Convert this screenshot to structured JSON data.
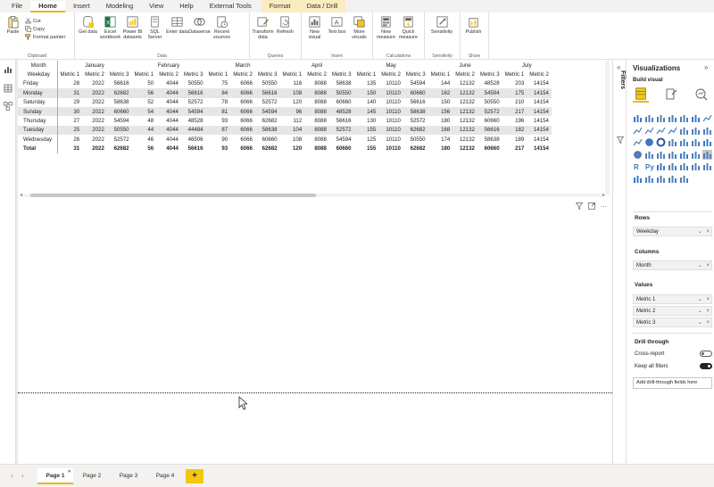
{
  "menu": {
    "tabs": [
      "File",
      "Home",
      "Insert",
      "Modeling",
      "View",
      "Help",
      "External Tools"
    ],
    "active": "Home",
    "context_tabs": [
      "Format",
      "Data / Drill"
    ]
  },
  "ribbon": {
    "clipboard": {
      "paste": "Paste",
      "cut": "Cut",
      "copy": "Copy",
      "format_painter": "Format painter",
      "group": "Clipboard"
    },
    "data": {
      "group": "Data",
      "buttons": [
        "Get data",
        "Excel workbook",
        "Power BI datasets",
        "SQL Server",
        "Enter data",
        "Dataverse",
        "Recent sources"
      ]
    },
    "queries": {
      "group": "Queries",
      "buttons": [
        "Transform data",
        "Refresh"
      ]
    },
    "insert": {
      "group": "Insert",
      "buttons": [
        "New visual",
        "Text box",
        "More visuals"
      ]
    },
    "calculations": {
      "group": "Calculations",
      "buttons": [
        "New measure",
        "Quick measure"
      ]
    },
    "sensitivity": {
      "group": "Sensitivity",
      "buttons": [
        "Sensitivity"
      ]
    },
    "share": {
      "group": "Share",
      "buttons": [
        "Publish"
      ]
    }
  },
  "matrix": {
    "row_header_title": "Month",
    "row_field": "Weekday",
    "months": [
      "January",
      "February",
      "March",
      "April",
      "May",
      "June",
      "July"
    ],
    "metric_headers": [
      "Metric 1",
      "Metric 2",
      "Metric 3"
    ],
    "rows": [
      {
        "label": "Friday",
        "values": [
          "28",
          "2022",
          "56616",
          "50",
          "4044",
          "50550",
          "75",
          "6066",
          "50550",
          "116",
          "8088",
          "58638",
          "135",
          "10110",
          "54594",
          "144",
          "12132",
          "48528",
          "203",
          "14154"
        ]
      },
      {
        "label": "Monday",
        "values": [
          "31",
          "2022",
          "62682",
          "56",
          "4044",
          "56616",
          "84",
          "6066",
          "56616",
          "108",
          "8088",
          "50550",
          "150",
          "10110",
          "60660",
          "162",
          "12132",
          "54594",
          "175",
          "14154"
        ]
      },
      {
        "label": "Saturday",
        "values": [
          "29",
          "2022",
          "58638",
          "52",
          "4044",
          "52572",
          "78",
          "6066",
          "52572",
          "120",
          "8088",
          "60660",
          "140",
          "10110",
          "56616",
          "150",
          "12132",
          "50550",
          "210",
          "14154"
        ]
      },
      {
        "label": "Sunday",
        "values": [
          "30",
          "2022",
          "60660",
          "54",
          "4044",
          "54594",
          "81",
          "6066",
          "54594",
          "96",
          "8088",
          "48528",
          "145",
          "10110",
          "58638",
          "156",
          "12132",
          "52572",
          "217",
          "14154"
        ]
      },
      {
        "label": "Thursday",
        "values": [
          "27",
          "2022",
          "54594",
          "48",
          "4044",
          "48528",
          "93",
          "6066",
          "62682",
          "112",
          "8088",
          "56616",
          "130",
          "10110",
          "52572",
          "180",
          "12132",
          "60660",
          "196",
          "14154"
        ]
      },
      {
        "label": "Tuesday",
        "values": [
          "25",
          "2022",
          "50550",
          "44",
          "4044",
          "44484",
          "87",
          "6066",
          "58638",
          "104",
          "8088",
          "52572",
          "155",
          "10110",
          "62682",
          "168",
          "12132",
          "56616",
          "182",
          "14154"
        ]
      },
      {
        "label": "Wednesday",
        "values": [
          "26",
          "2022",
          "52572",
          "46",
          "4044",
          "46506",
          "90",
          "6066",
          "60660",
          "108",
          "8088",
          "54594",
          "125",
          "10110",
          "50550",
          "174",
          "12132",
          "58638",
          "189",
          "14154"
        ]
      }
    ],
    "total": {
      "label": "Total",
      "values": [
        "31",
        "2022",
        "62682",
        "56",
        "4044",
        "56616",
        "93",
        "6066",
        "62682",
        "120",
        "8088",
        "60660",
        "155",
        "10110",
        "62682",
        "180",
        "12132",
        "60660",
        "217",
        "14154"
      ]
    }
  },
  "pages": {
    "tabs": [
      "Page 1",
      "Page 2",
      "Page 3",
      "Page 4"
    ],
    "active": "Page 1",
    "add": "+"
  },
  "filters": {
    "label": "Filters"
  },
  "viz": {
    "title": "Visualizations",
    "build_visual": "Build visual",
    "rows_label": "Rows",
    "rows_field": "Weekday",
    "columns_label": "Columns",
    "columns_field": "Month",
    "values_label": "Values",
    "values_fields": [
      "Metric 1",
      "Metric 2",
      "Metric 3"
    ],
    "drill_label": "Drill through",
    "cross_report": "Cross-report",
    "keep_filters": "Keep all filters",
    "add_drill": "Add drill-through fields here",
    "r_visual": "R",
    "py_visual": "Py",
    "more": "..."
  },
  "colors": {
    "accent": "#f2c811",
    "tab_underline": "#e8b818",
    "band": "#e6e6e6",
    "context_tab_bg": "#fbecc0"
  }
}
